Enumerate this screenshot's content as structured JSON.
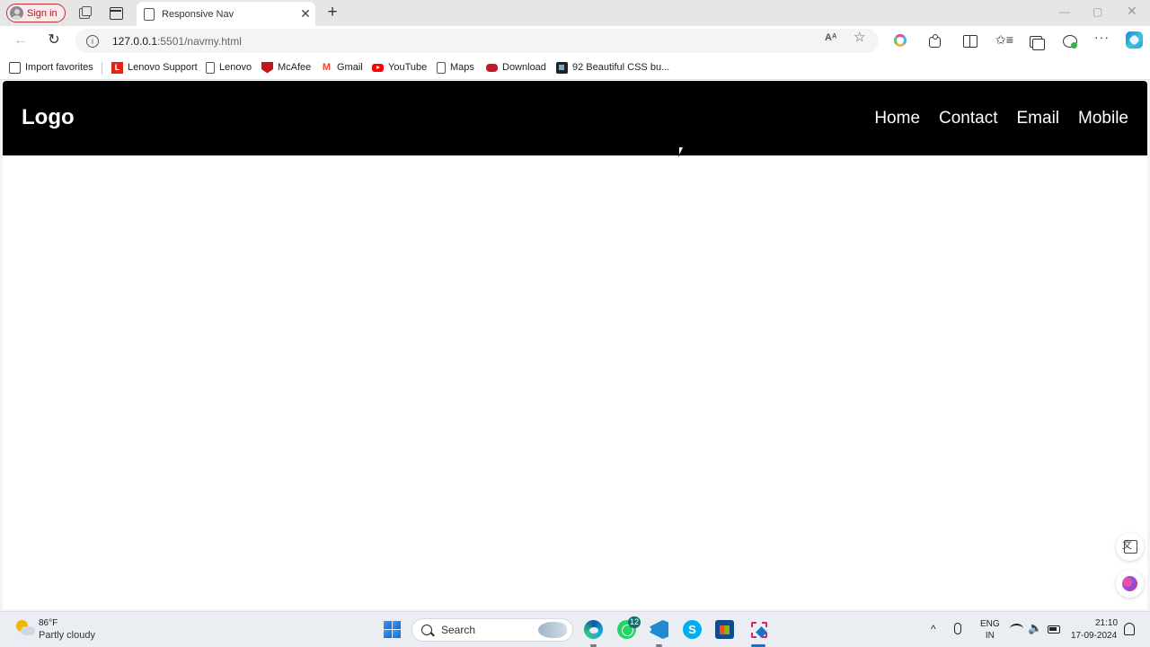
{
  "browser": {
    "sign_in_label": "Sign in",
    "tab": {
      "title": "Responsive Nav",
      "close_glyph": "✕"
    },
    "new_tab_glyph": "+",
    "window_controls": {
      "minimize": "—",
      "maximize": "▢",
      "close": "✕"
    },
    "address": {
      "host": "127.0.0.1",
      "rest": ":5501/navmy.html"
    },
    "read_aloud_glyph": "Aᴬ",
    "favorite_star_glyph": "☆",
    "favorites_glyph": "✩≡",
    "more_glyph": "···",
    "favorites": [
      {
        "label": "Import favorites",
        "icon": "import-icon"
      },
      {
        "label": "Lenovo Support",
        "icon": "lenovo-icon"
      },
      {
        "label": "Lenovo",
        "icon": "page-icon"
      },
      {
        "label": "McAfee",
        "icon": "mcafee-icon"
      },
      {
        "label": "Gmail",
        "icon": "gmail-icon"
      },
      {
        "label": "YouTube",
        "icon": "youtube-icon"
      },
      {
        "label": "Maps",
        "icon": "page-icon"
      },
      {
        "label": "Download",
        "icon": "gamepad-icon"
      },
      {
        "label": "92 Beautiful CSS bu...",
        "icon": "css-icon"
      }
    ],
    "lenovo_glyph": "L",
    "gmail_glyph": "M"
  },
  "page": {
    "logo": "Logo",
    "nav_links": [
      "Home",
      "Contact",
      "Email",
      "Mobile"
    ]
  },
  "taskbar": {
    "weather": {
      "temp": "86°F",
      "desc": "Partly cloudy"
    },
    "search_label": "Search",
    "whatsapp_badge": "12",
    "skype_glyph": "S",
    "tray_caret": "^",
    "volume_glyph": "🔈",
    "lang": {
      "line1": "ENG",
      "line2": "IN"
    },
    "clock": {
      "time": "21:10",
      "date": "17-09-2024"
    }
  },
  "colors": {
    "nav_background": "#000000",
    "nav_text": "#ffffff",
    "signin_border": "#c0303a"
  }
}
